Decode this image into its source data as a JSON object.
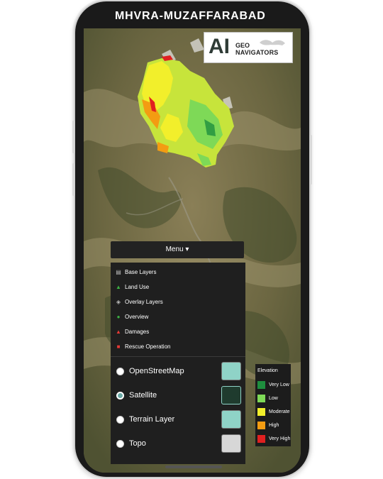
{
  "app": {
    "title": "MHVRA-MUZAFFARABAD"
  },
  "logo": {
    "ai": "AI",
    "geo": "GEO",
    "navigators": "NAVIGATORS"
  },
  "menu": {
    "button_label": "Menu ▾",
    "items": [
      {
        "label": "Base Layers",
        "icon": "map-icon",
        "color": "#bdbdbd"
      },
      {
        "label": "Land Use",
        "icon": "tree-icon",
        "color": "#3cb043"
      },
      {
        "label": "Overlay Layers",
        "icon": "layers-icon",
        "color": "#bdbdbd"
      },
      {
        "label": "Overview",
        "icon": "globe-icon",
        "color": "#3cb043"
      },
      {
        "label": "Damages",
        "icon": "warning-icon",
        "color": "#e53935"
      },
      {
        "label": "Rescue Operation",
        "icon": "truck-icon",
        "color": "#e53935"
      }
    ]
  },
  "base_layers": [
    {
      "label": "OpenStreetMap",
      "selected": false,
      "thumb_color": "#8fd3c7"
    },
    {
      "label": "Satellite",
      "selected": true,
      "thumb_color": "#1f3b2e"
    },
    {
      "label": "Terrain Layer",
      "selected": false,
      "thumb_color": "#8fd3c7"
    },
    {
      "label": "Topo",
      "selected": false,
      "thumb_color": "#d7d7d7"
    }
  ],
  "legend": {
    "title": "Elevation",
    "items": [
      {
        "label": "Very Low",
        "color": "#1e8e3e"
      },
      {
        "label": "Low",
        "color": "#7ed957"
      },
      {
        "label": "Moderate",
        "color": "#f2ef2b"
      },
      {
        "label": "High",
        "color": "#f39c12"
      },
      {
        "label": "Very High",
        "color": "#e02020"
      }
    ]
  }
}
